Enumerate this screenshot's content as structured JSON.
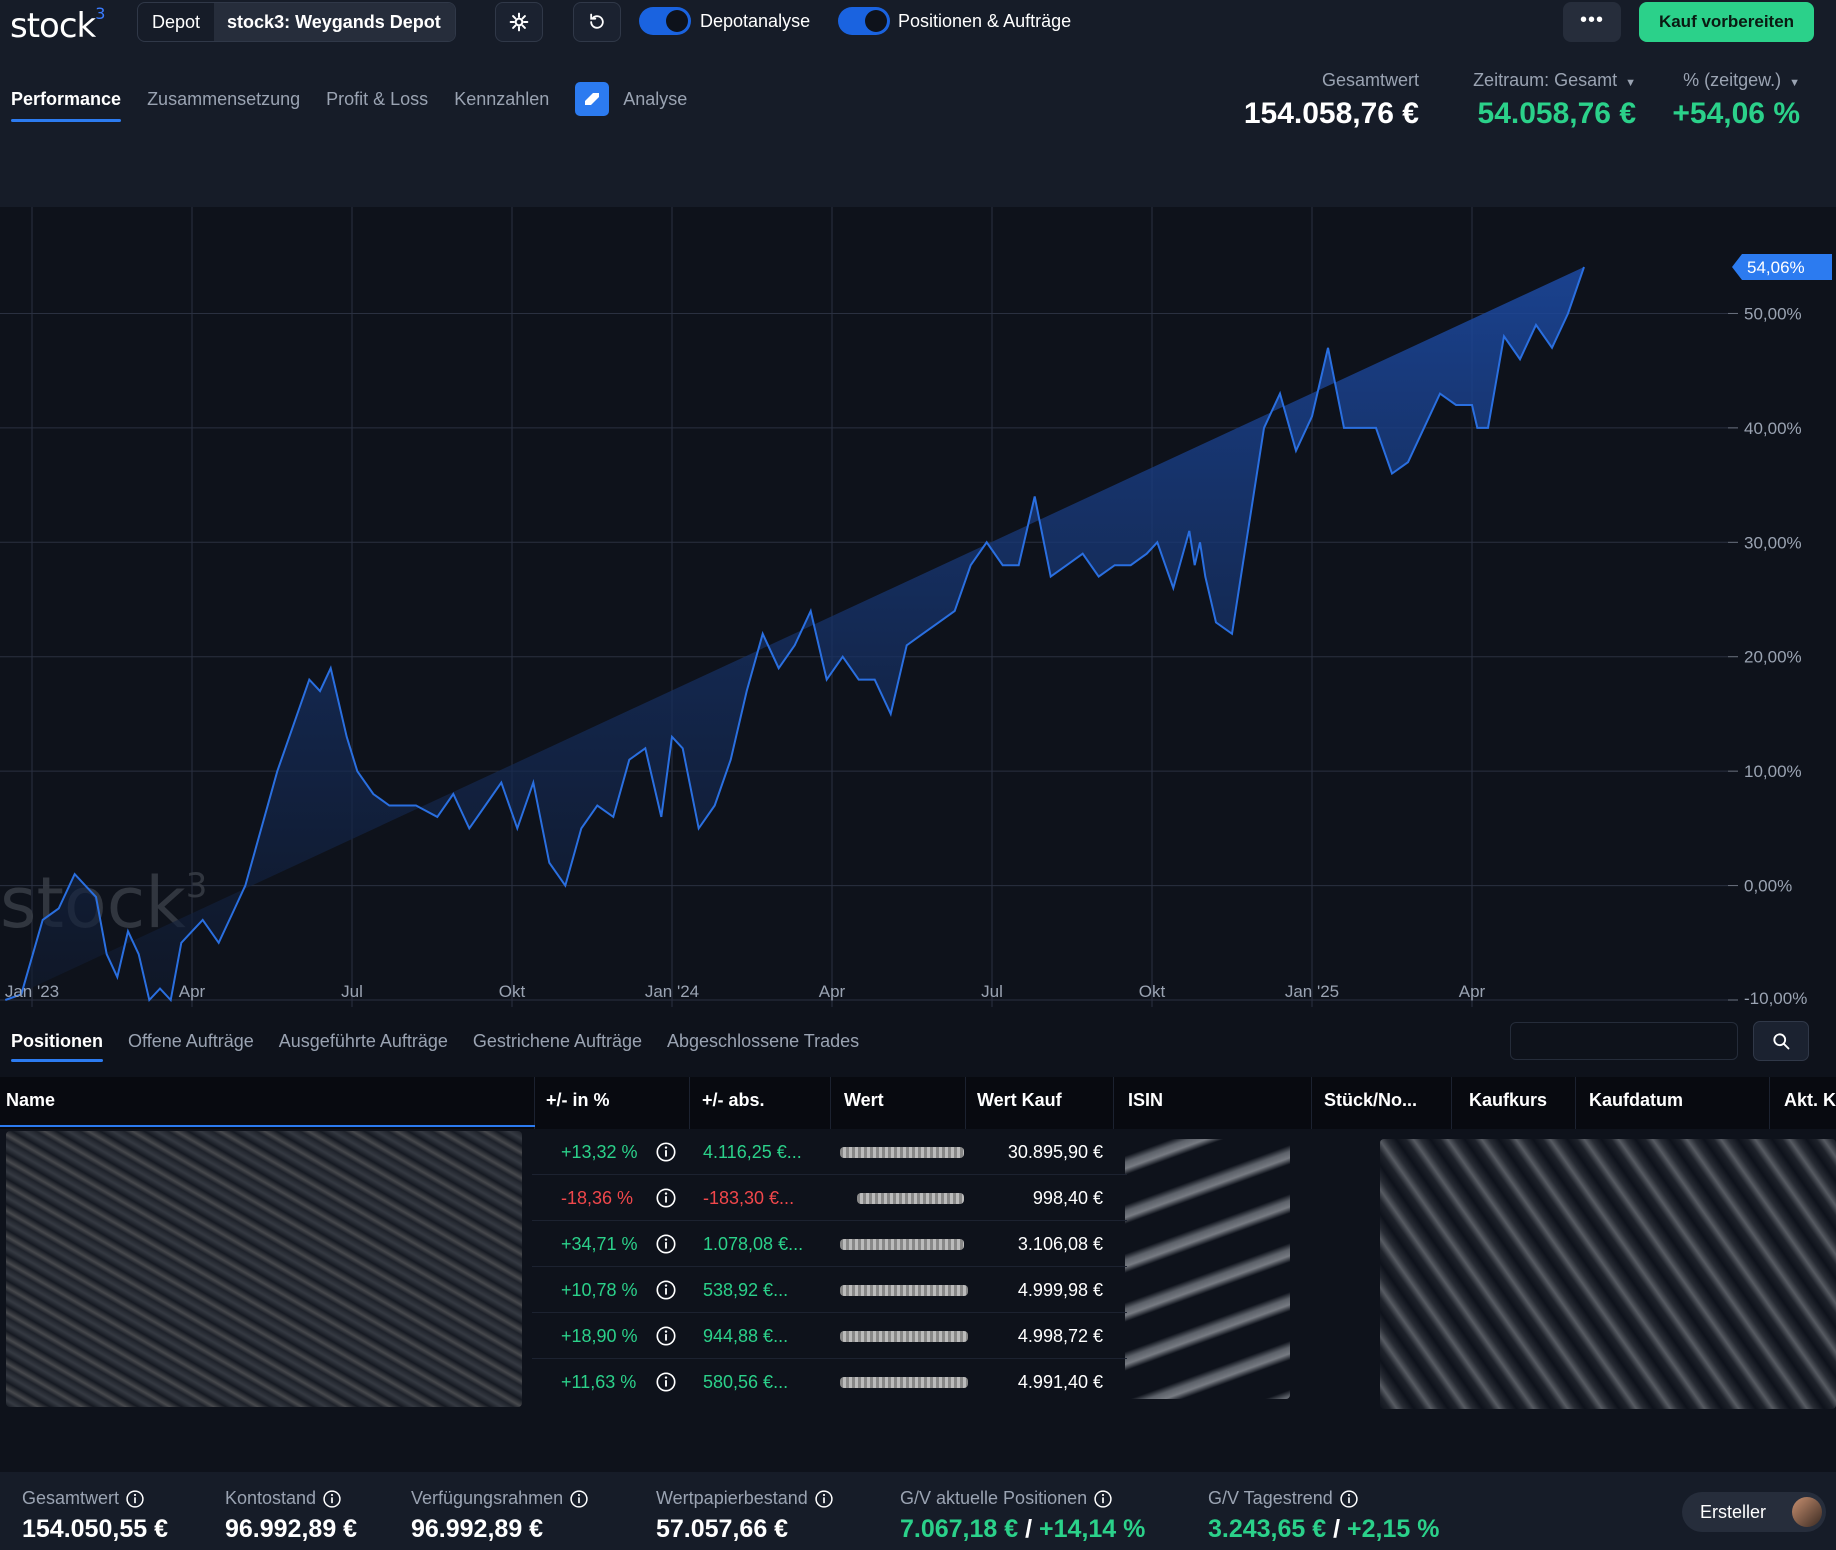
{
  "app": {
    "logo": "stock",
    "logo_sup": "3"
  },
  "header": {
    "depot_label": "Depot",
    "depot_name": "stock3: Weygands Depot",
    "toggle1_label": "Depotanalyse",
    "toggle2_label": "Positionen & Aufträge",
    "more_label": "•••",
    "buy_label": "Kauf vorbereiten",
    "icons": [
      "gear-icon",
      "refresh-icon"
    ]
  },
  "nav": {
    "items": [
      "Performance",
      "Zusammensetzung",
      "Profit & Loss",
      "Kennzahlen"
    ],
    "analyse_label": "Analyse"
  },
  "kpis": {
    "total_label": "Gesamtwert",
    "total_value": "154.058,76 €",
    "period_label": "Zeitraum: Gesamt",
    "period_value": "54.058,76 €",
    "pct_label": "% (zeitgew.)",
    "pct_value": "+54,06 %"
  },
  "chart_data": {
    "type": "area",
    "current_label": "54,06%",
    "watermark": "stock",
    "watermark_sup": "3",
    "y_ticks": [
      {
        "v": 50,
        "label": "50,00%"
      },
      {
        "v": 40,
        "label": "40,00%"
      },
      {
        "v": 30,
        "label": "30,00%"
      },
      {
        "v": 20,
        "label": "20,00%"
      },
      {
        "v": 10,
        "label": "10,00%"
      },
      {
        "v": 0,
        "label": "0,00%"
      },
      {
        "v": -10,
        "label": "-10,00%"
      }
    ],
    "ylim": [
      -10,
      54.06
    ],
    "x_ticks": [
      {
        "t": 0,
        "label": "Jan '23"
      },
      {
        "t": 3,
        "label": "Apr"
      },
      {
        "t": 6,
        "label": "Jul"
      },
      {
        "t": 9,
        "label": "Okt"
      },
      {
        "t": 12,
        "label": "Jan '24"
      },
      {
        "t": 15,
        "label": "Apr"
      },
      {
        "t": 18,
        "label": "Jul"
      },
      {
        "t": 21,
        "label": "Okt"
      },
      {
        "t": 24,
        "label": "Jan '25"
      },
      {
        "t": 27,
        "label": "Apr"
      }
    ],
    "xlim": [
      -0.6,
      31.8
    ],
    "x": [
      -0.5,
      -0.2,
      0.2,
      0.5,
      0.8,
      1.0,
      1.2,
      1.4,
      1.6,
      1.8,
      2.0,
      2.2,
      2.4,
      2.6,
      2.8,
      3.0,
      3.2,
      3.5,
      3.8,
      4.0,
      4.3,
      4.6,
      4.9,
      5.2,
      5.4,
      5.6,
      5.9,
      6.1,
      6.4,
      6.7,
      7.0,
      7.2,
      7.6,
      7.9,
      8.2,
      8.5,
      8.8,
      9.1,
      9.4,
      9.7,
      10.0,
      10.3,
      10.6,
      10.9,
      11.2,
      11.5,
      11.8,
      12.0,
      12.2,
      12.5,
      12.8,
      13.1,
      13.4,
      13.7,
      14.0,
      14.3,
      14.6,
      14.9,
      15.2,
      15.5,
      15.8,
      16.1,
      16.4,
      16.7,
      17.0,
      17.3,
      17.6,
      17.9,
      18.2,
      18.5,
      18.8,
      19.1,
      19.4,
      19.7,
      20.0,
      20.3,
      20.6,
      20.9,
      21.1,
      21.4,
      21.7,
      21.8,
      21.9,
      22.0,
      22.2,
      22.5,
      22.8,
      23.1,
      23.4,
      23.7,
      24.0,
      24.3,
      24.6,
      24.9,
      25.2,
      25.5,
      25.8,
      26.1,
      26.4,
      26.7,
      27.0,
      27.1,
      27.3,
      27.6,
      27.9,
      28.2,
      28.5,
      28.8,
      29.1,
      29.3
    ],
    "values": [
      -10,
      -9.5,
      -3,
      -2,
      1,
      0,
      -1,
      -6,
      -8,
      -4,
      -6,
      -10,
      -9,
      -10,
      -5,
      -4,
      -3,
      -5,
      -2,
      0,
      5,
      10,
      14,
      18,
      17,
      19,
      13,
      10,
      8,
      7,
      7,
      7,
      6,
      8,
      5,
      7,
      9,
      5,
      9,
      2,
      0,
      5,
      7,
      6,
      11,
      12,
      6,
      13,
      12,
      5,
      7,
      11,
      17,
      22,
      19,
      21,
      24,
      18,
      20,
      18,
      18,
      15,
      21,
      22,
      23,
      24,
      28,
      30,
      28,
      28,
      34,
      27,
      28,
      29,
      27,
      28,
      28,
      29,
      30,
      26,
      31,
      28,
      30,
      27,
      23,
      22,
      31,
      40,
      43,
      38,
      41,
      47,
      40,
      40,
      40,
      36,
      37,
      40,
      43,
      42,
      42,
      40,
      40,
      48,
      46,
      49,
      47,
      50,
      54.06
    ]
  },
  "tabs": [
    "Positionen",
    "Offene Aufträge",
    "Ausgeführte Aufträge",
    "Gestrichene Aufträge",
    "Abgeschlossene Trades"
  ],
  "table": {
    "headers": [
      "Name",
      "+/- in %",
      "+/- abs.",
      "Wert",
      "Wert Kauf",
      "ISIN",
      "Stück/No...",
      "Kaufkurs",
      "Kaufdatum",
      "Akt. K"
    ],
    "rows": [
      {
        "pct": "+13,32 %",
        "abs": "4.116,25 €...",
        "kauf": "30.895,90 €",
        "sign": "pos"
      },
      {
        "pct": "-18,36 %",
        "abs": "-183,30 €...",
        "kauf": "998,40 €",
        "sign": "neg"
      },
      {
        "pct": "+34,71 %",
        "abs": "1.078,08 €...",
        "kauf": "3.106,08 €",
        "sign": "pos"
      },
      {
        "pct": "+10,78 %",
        "abs": "538,92 €...",
        "kauf": "4.999,98 €",
        "sign": "pos"
      },
      {
        "pct": "+18,90 %",
        "abs": "944,88 €...",
        "kauf": "4.998,72 €",
        "sign": "pos"
      },
      {
        "pct": "+11,63 %",
        "abs": "580,56 €...",
        "kauf": "4.991,40 €",
        "sign": "pos"
      }
    ]
  },
  "footer": {
    "gesamtwert_label": "Gesamtwert",
    "gesamtwert_value": "154.050,55 €",
    "kontostand_label": "Kontostand",
    "kontostand_value": "96.992,89 €",
    "verfuegung_label": "Verfügungsrahmen",
    "verfuegung_value": "96.992,89 €",
    "wertpapier_label": "Wertpapierbestand",
    "wertpapier_value": "57.057,66 €",
    "gv_label": "G/V aktuelle Positionen",
    "gv_abs": "7.067,18 €",
    "gv_sep": "/",
    "gv_pct": "+14,14 %",
    "tag_label": "G/V Tagestrend",
    "tag_abs": "3.243,65 €",
    "tag_sep": "/",
    "tag_pct": "+2,15 %",
    "creator_label": "Ersteller"
  },
  "colors": {
    "accent": "#2c7bf0",
    "buy": "#2bd18a",
    "negative": "#f0474b",
    "line": "#2a6fe0"
  }
}
